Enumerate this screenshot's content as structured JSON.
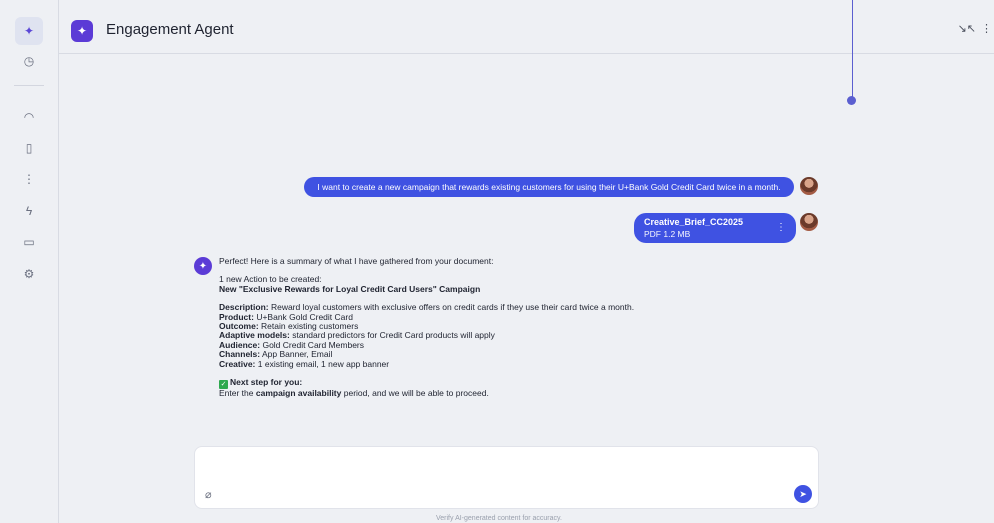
{
  "app": {
    "title": "Engagement Agent"
  },
  "rail": {
    "items": [
      {
        "name": "agent-sparkle-icon",
        "glyph": "✦"
      },
      {
        "name": "history-clock-icon",
        "glyph": "◷"
      },
      {
        "name": "dashboard-gauge-icon",
        "glyph": "◠"
      },
      {
        "name": "book-icon",
        "glyph": "▯"
      },
      {
        "name": "journey-icon",
        "glyph": "⋮"
      },
      {
        "name": "lightning-icon",
        "glyph": "ϟ"
      },
      {
        "name": "devices-icon",
        "glyph": "▭"
      },
      {
        "name": "settings-gear-icon",
        "glyph": "⚙"
      }
    ]
  },
  "header": {
    "collapse_glyph": "↘↖",
    "menu_glyph": "⋮"
  },
  "conversation": {
    "user_message": "I want to create a new campaign that rewards existing customers for using their U+Bank Gold Credit Card twice in a month.",
    "attachment": {
      "name": "Creative_Brief_CC2025",
      "meta": "PDF 1.2 MB",
      "menu_glyph": "⋮"
    },
    "assistant": {
      "intro": "Perfect! Here is a summary of what I have gathered from your document:",
      "action_count": "1 new Action to be created:",
      "action_title": "New \"Exclusive Rewards for Loyal Credit Card Users\" Campaign",
      "fields": [
        {
          "label": "Description:",
          "value": " Reward loyal customers with exclusive offers on credit cards if they use their card twice a month."
        },
        {
          "label": "Product:",
          "value": " U+Bank Gold Credit Card"
        },
        {
          "label": "Outcome:",
          "value": " Retain existing customers"
        },
        {
          "label": "Adaptive models:",
          "value": " standard predictors for Credit Card products will apply"
        },
        {
          "label": "Audience:",
          "value": " Gold Credit Card Members"
        },
        {
          "label": "Channels:",
          "value": " App Banner, Email"
        },
        {
          "label": "Creative:",
          "value": " 1 existing email, 1 new app banner"
        }
      ],
      "next_step_label": "Next step for you:",
      "next_step_pre": "Enter the ",
      "next_step_bold": "campaign availability",
      "next_step_post": " period, and we will be able to proceed."
    }
  },
  "composer": {
    "placeholder": "",
    "clip_glyph": "⌀",
    "send_glyph": "➤"
  },
  "footer": {
    "disclaimer": "Verify AI-generated content for accuracy."
  },
  "colors": {
    "accent": "#3f52e2",
    "brand": "#5b3bd6",
    "timeline": "#5b5fd0"
  }
}
